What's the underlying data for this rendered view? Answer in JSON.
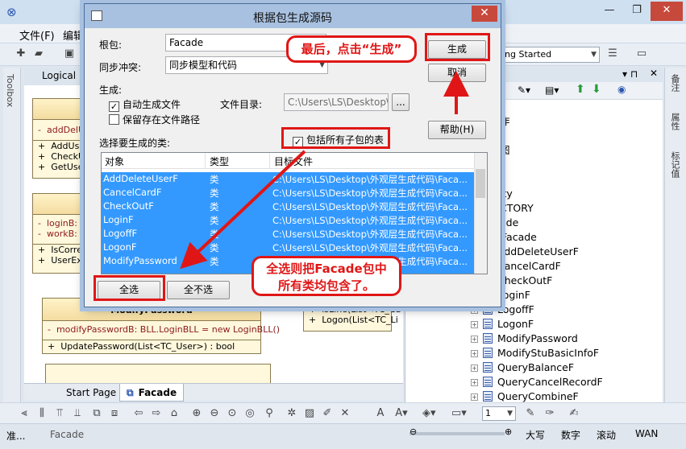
{
  "app": {
    "menu": [
      "文件(F)",
      "编辑"
    ],
    "diagram_tab": "Logical",
    "toolbox_label": "Toolbox",
    "toolbar_combo": "ing Started",
    "bottom_tabs": [
      "Start Page",
      "Facade"
    ],
    "status": {
      "left": "准...",
      "element": "Facade",
      "zoom_value": "1",
      "caps": "大写",
      "num": "数字",
      "scroll": "滚动",
      "wan": "WAN"
    },
    "side_tabs": [
      "备注",
      "属性",
      "标记值"
    ],
    "uml": {
      "box1": {
        "ops_red": "addDelUs",
        "ops": [
          "AddUserF",
          "CheckUse",
          "GetUserN"
        ]
      },
      "box2": {
        "attrs": [
          "loginB:",
          "workB:  B"
        ],
        "ops": [
          "IsCorrect",
          "UserExit("
        ]
      },
      "box3": {
        "title": "ModifyPassword",
        "attr": "modifyPasswordB:  BLL.LoginBLL = new LoginBLL()",
        "op": "UpdatePassword(List<TC_User>) : bool"
      },
      "box4": {
        "ops": [
          "isLine(List<TC_Ca",
          "Logon(List<TC_Li"
        ]
      }
    },
    "tree": {
      "partial": [
        "作",
        "图",
        "L",
        "ity",
        "CTORY",
        "ade"
      ],
      "root": "Facade",
      "items": [
        "AddDeleteUserF",
        "CancelCardF",
        "CheckOutF",
        "LoginF",
        "LogoffF",
        "LogonF",
        "ModifyPassword",
        "ModifyStuBasicInfoF",
        "QueryBalanceF",
        "QueryCancelRecordF",
        "QueryCombineF"
      ]
    }
  },
  "dialog": {
    "title": "根据包生成源码",
    "root_label": "根包:",
    "root_value": "Facade",
    "sync_label": "同步冲突:",
    "sync_value": "同步模型和代码",
    "gen_label": "生成:",
    "auto_gen": "自动生成文件",
    "keep_path": "保留存在文件路径",
    "dir_label": "文件目录:",
    "dir_value": "C:\\Users\\LS\\Desktop\\外观",
    "browse_label": "...",
    "include_sub": "包括所有子包的表",
    "select_label": "选择要生成的类:",
    "columns": [
      "对象",
      "类型",
      "目标文件"
    ],
    "rows": [
      {
        "name": "AddDeleteUserF",
        "type": "类",
        "target": "C:\\Users\\LS\\Desktop\\外观层生成代码\\Faca..."
      },
      {
        "name": "CancelCardF",
        "type": "类",
        "target": "C:\\Users\\LS\\Desktop\\外观层生成代码\\Faca..."
      },
      {
        "name": "CheckOutF",
        "type": "类",
        "target": "C:\\Users\\LS\\Desktop\\外观层生成代码\\Faca..."
      },
      {
        "name": "LoginF",
        "type": "类",
        "target": "C:\\Users\\LS\\Desktop\\外观层生成代码\\Faca..."
      },
      {
        "name": "LogoffF",
        "type": "类",
        "target": "C:\\Users\\LS\\Desktop\\外观层生成代码\\Faca..."
      },
      {
        "name": "LogonF",
        "type": "类",
        "target": "C:\\Users\\LS\\Desktop\\外观层生成代码\\Faca..."
      },
      {
        "name": "ModifyPassword",
        "type": "类",
        "target": "C:\\Users\\LS\\Desktop\\外观层生成代码\\Faca..."
      }
    ],
    "buttons": {
      "generate": "生成",
      "cancel": "取消",
      "help": "帮助(H)",
      "select_all": "全选",
      "select_none": "全不选"
    }
  },
  "annotations": {
    "callout_generate": "最后，点击“生成”",
    "callout_select_all": "全选则把Facade包中所有类均包含了。"
  },
  "colors": {
    "accent": "#3399ff",
    "annotation_red": "#e01616",
    "close_red": "#c7493c",
    "dialog_frame": "#a8c1e0"
  }
}
